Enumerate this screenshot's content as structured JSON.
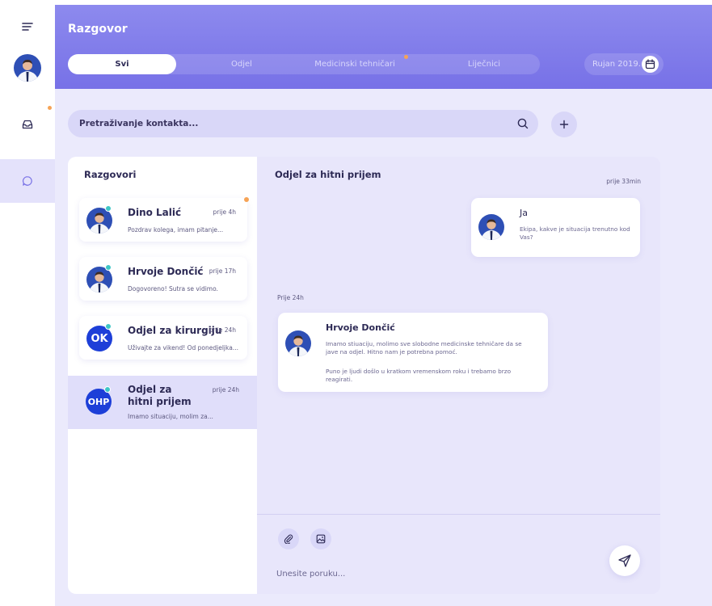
{
  "header": {
    "title": "Razgovor",
    "tabs": [
      {
        "label": "Svi",
        "active": true
      },
      {
        "label": "Odjel",
        "active": false
      },
      {
        "label": "Medicinski tehničari",
        "active": false,
        "notification": true
      },
      {
        "label": "Liječnici",
        "active": false
      }
    ],
    "date_label": "Rujan 2019."
  },
  "sidebar": {
    "items": [
      {
        "icon": "menu-icon"
      },
      {
        "icon": "avatar"
      },
      {
        "icon": "inbox-icon",
        "notification": true
      },
      {
        "icon": "chat-icon",
        "active": true
      }
    ]
  },
  "search": {
    "placeholder": "Pretraživanje kontakta..."
  },
  "conversations": {
    "title": "Razgovori",
    "items": [
      {
        "name": "Dino Lalić",
        "time": "prije 4h",
        "preview": "Pozdrav kolega, imam pitanje...",
        "avatar": "photo",
        "online": true,
        "unread": true
      },
      {
        "name": "Hrvoje Dončić",
        "time": "prije 17h",
        "preview": "Dogovoreno! Sutra se vidimo.",
        "avatar": "photo",
        "online": true
      },
      {
        "name": "Odjel za kirurgiju",
        "time": "prije 24h",
        "preview": "Uživajte za vikend! Od ponedjeljka...",
        "avatar": "OK",
        "online": true
      },
      {
        "name": "Odjel za hitni prijem",
        "name_line1": "Odjel za",
        "name_line2": "hitni prijem",
        "time": "prije 24h",
        "preview": "Imamo situaciju, molim za...",
        "avatar": "OHP",
        "online": true,
        "active": true
      }
    ]
  },
  "chat": {
    "title": "Odjel za hitni prijem",
    "time_top": "prije 33min",
    "messages": [
      {
        "sender": "Ja",
        "text": "Ekipa, kakve je situacija trenutno kod Vas?"
      },
      {
        "time": "Prije 24h",
        "sender": "Hrvoje Dončić",
        "text": "Imamo stiuaciju, molimo sve slobodne medicinske tehničare da se jave na odjel. Hitno nam je potrebna pomoć.",
        "text2": "Puno je ljudi došlo u kratkom vremenskom roku i trebamo brzo reagirati."
      }
    ],
    "input_placeholder": "Unesite poruku..."
  },
  "colors": {
    "header_gradient_top": "#8d8aee",
    "header_gradient_bottom": "#7771e7",
    "background": "#ebeafc",
    "notification_dot": "#f6a356",
    "online_dot": "#3ec6c6",
    "group_avatar": "#1d3fd8"
  }
}
